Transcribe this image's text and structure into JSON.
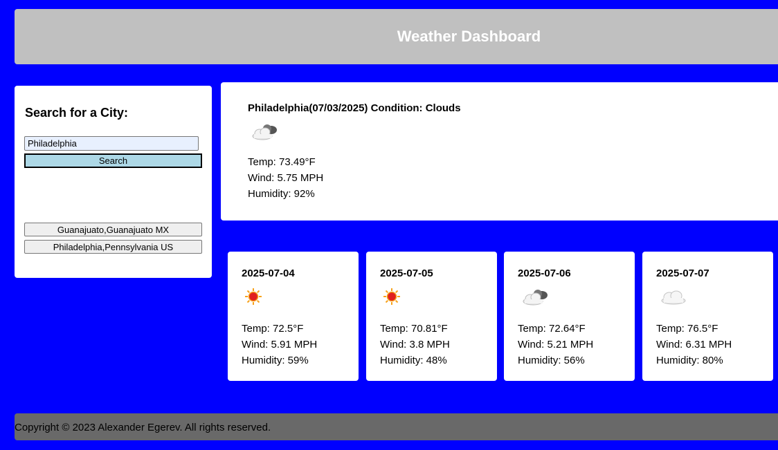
{
  "header": {
    "title": "Weather Dashboard"
  },
  "sidebar": {
    "heading": "Search for a City:",
    "search_value": "Philadelphia",
    "search_button": "Search",
    "history": [
      "Guanajuato,Guanajuato MX",
      "Philadelphia,Pennsylvania US"
    ]
  },
  "current": {
    "title": "Philadelphia(07/03/2025) Condition: Clouds",
    "icon": "cloudy-sun-icon",
    "temp": "Temp: 73.49°F",
    "wind": "Wind: 5.75 MPH",
    "humidity": "Humidity: 92%"
  },
  "forecast": [
    {
      "date": "2025-07-04",
      "icon": "sun-icon",
      "temp": "Temp: 72.5°F",
      "wind": "Wind: 5.91 MPH",
      "humidity": "Humidity: 59%"
    },
    {
      "date": "2025-07-05",
      "icon": "sun-icon",
      "temp": "Temp: 70.81°F",
      "wind": "Wind: 3.8 MPH",
      "humidity": "Humidity: 48%"
    },
    {
      "date": "2025-07-06",
      "icon": "cloudy-sun-icon",
      "temp": "Temp: 72.64°F",
      "wind": "Wind: 5.21 MPH",
      "humidity": "Humidity: 56%"
    },
    {
      "date": "2025-07-07",
      "icon": "cloud-icon",
      "temp": "Temp: 76.5°F",
      "wind": "Wind: 6.31 MPH",
      "humidity": "Humidity: 80%"
    }
  ],
  "footer": {
    "text": "Copyright © 2023 Alexander Egerev. All rights reserved."
  },
  "colors": {
    "background": "#0000FF",
    "header": "#C0C0C0",
    "footer": "#696969",
    "search_button": "#ADD8E6"
  }
}
